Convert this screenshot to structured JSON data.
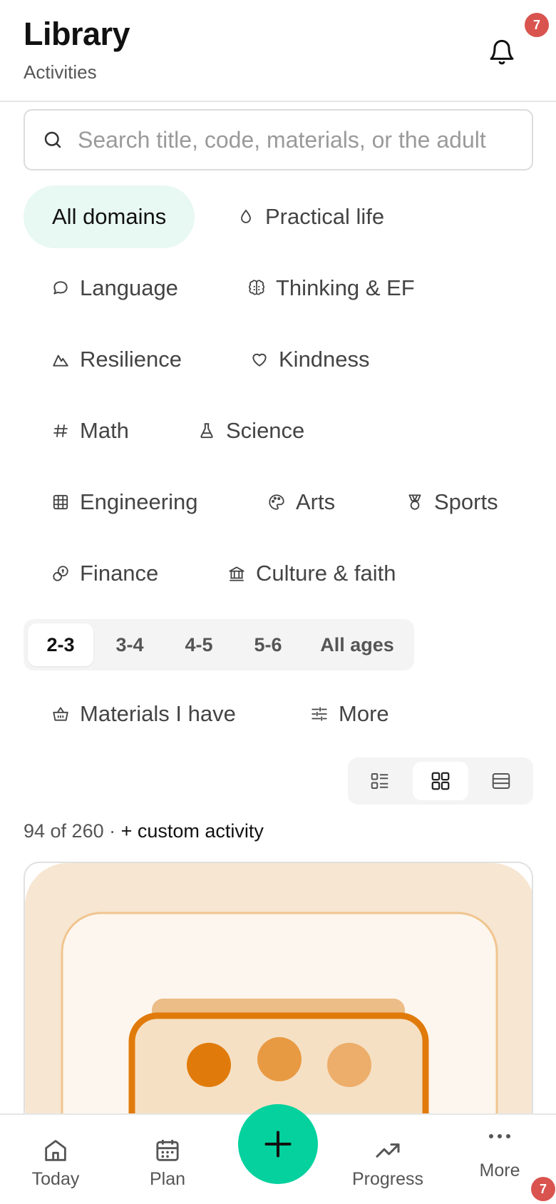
{
  "header": {
    "title": "Library",
    "subtitle": "Activities",
    "notification_count": "7",
    "bell_icon": "bell-icon"
  },
  "search": {
    "placeholder": "Search title, code, materials, or the adult",
    "value": ""
  },
  "domains": [
    {
      "label": "All domains",
      "icon": "",
      "active": true
    },
    {
      "label": "Practical life",
      "icon": "drop-icon"
    },
    {
      "label": "Language",
      "icon": "speech-bubble-icon"
    },
    {
      "label": "Thinking & EF",
      "icon": "brain-icon"
    },
    {
      "label": "Resilience",
      "icon": "mountain-icon"
    },
    {
      "label": "Kindness",
      "icon": "heart-icon"
    },
    {
      "label": "Math",
      "icon": "hash-icon"
    },
    {
      "label": "Science",
      "icon": "flask-icon"
    },
    {
      "label": "Engineering",
      "icon": "grid-frame-icon"
    },
    {
      "label": "Arts",
      "icon": "palette-icon"
    },
    {
      "label": "Sports",
      "icon": "medal-icon"
    },
    {
      "label": "Finance",
      "icon": "coins-icon"
    },
    {
      "label": "Culture & faith",
      "icon": "landmark-icon"
    }
  ],
  "ages": [
    {
      "label": "2-3",
      "active": true
    },
    {
      "label": "3-4"
    },
    {
      "label": "4-5"
    },
    {
      "label": "5-6"
    },
    {
      "label": "All ages"
    }
  ],
  "filters": {
    "materials_label": "Materials I have",
    "more_label": "More"
  },
  "view_modes": [
    "list-icon",
    "grid-icon",
    "rows-icon"
  ],
  "active_view": "grid-icon",
  "results": {
    "count_text": "94 of 260 ·",
    "custom_link": "+ custom activity"
  },
  "colors": {
    "accent": "#04d19e",
    "active_chip_bg": "#e8f8f2",
    "badge": "#d9534f",
    "card_orange": "#e07b0b",
    "card_peach": "#f6e6d2"
  },
  "nav": {
    "today": "Today",
    "plan": "Plan",
    "progress": "Progress",
    "more": "More",
    "more_badge": "7"
  }
}
